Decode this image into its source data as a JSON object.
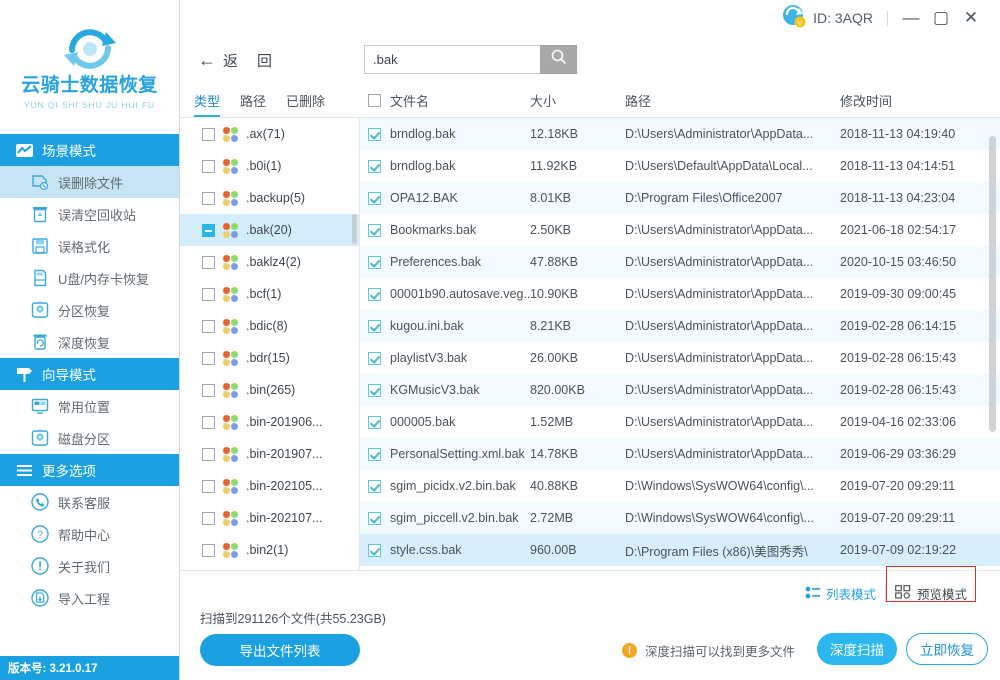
{
  "brand": {
    "title": "云骑士数据恢复",
    "subtitle": "YUN QI SHI SHU JU HUI FU",
    "version": "版本号: 3.21.0.17",
    "accent": "#1ba1e2",
    "accent_light": "#29b7e8"
  },
  "titlebar": {
    "id_label": "ID: 3AQR",
    "minimize": "—",
    "maximize": "▢",
    "close": "✕"
  },
  "toolbar": {
    "back_label": "返",
    "back_label2": "回",
    "search_value": ".bak",
    "search_placeholder": ""
  },
  "tree": {
    "tabs": [
      {
        "label": "类型",
        "active": true
      },
      {
        "label": "路径",
        "active": false
      },
      {
        "label": "已删除",
        "active": false
      }
    ],
    "items": [
      {
        "label": ".ax(71)",
        "state": "unchecked"
      },
      {
        "label": ".b0i(1)",
        "state": "unchecked"
      },
      {
        "label": ".backup(5)",
        "state": "unchecked"
      },
      {
        "label": ".bak(20)",
        "state": "partial"
      },
      {
        "label": ".baklz4(2)",
        "state": "unchecked"
      },
      {
        "label": ".bcf(1)",
        "state": "unchecked"
      },
      {
        "label": ".bdic(8)",
        "state": "unchecked"
      },
      {
        "label": ".bdr(15)",
        "state": "unchecked"
      },
      {
        "label": ".bin(265)",
        "state": "unchecked"
      },
      {
        "label": ".bin-201906...",
        "state": "unchecked"
      },
      {
        "label": ".bin-201907...",
        "state": "unchecked"
      },
      {
        "label": ".bin-202105...",
        "state": "unchecked"
      },
      {
        "label": ".bin-202107...",
        "state": "unchecked"
      },
      {
        "label": ".bin2(1)",
        "state": "unchecked"
      }
    ]
  },
  "filelist": {
    "columns": [
      "文件名",
      "大小",
      "路径",
      "修改时间"
    ],
    "rows": [
      {
        "name": "brndlog.bak",
        "size": "12.18KB",
        "path": "D:\\Users\\Administrator\\AppData...",
        "time": "2018-11-13 04:19:40",
        "checked": true
      },
      {
        "name": "brndlog.bak",
        "size": "11.92KB",
        "path": "D:\\Users\\Default\\AppData\\Local...",
        "time": "2018-11-13 04:14:51",
        "checked": true
      },
      {
        "name": "OPA12.BAK",
        "size": "8.01KB",
        "path": "D:\\Program Files\\Office2007",
        "time": "2018-11-13 04:23:04",
        "checked": true
      },
      {
        "name": "Bookmarks.bak",
        "size": "2.50KB",
        "path": "D:\\Users\\Administrator\\AppData...",
        "time": "2021-06-18 02:54:17",
        "checked": true
      },
      {
        "name": "Preferences.bak",
        "size": "47.88KB",
        "path": "D:\\Users\\Administrator\\AppData...",
        "time": "2020-10-15 03:46:50",
        "checked": true
      },
      {
        "name": "00001b90.autosave.veg....",
        "size": "10.90KB",
        "path": "D:\\Users\\Administrator\\AppData...",
        "time": "2019-09-30 09:00:45",
        "checked": true
      },
      {
        "name": "kugou.ini.bak",
        "size": "8.21KB",
        "path": "D:\\Users\\Administrator\\AppData...",
        "time": "2019-02-28 06:14:15",
        "checked": true
      },
      {
        "name": "playlistV3.bak",
        "size": "26.00KB",
        "path": "D:\\Users\\Administrator\\AppData...",
        "time": "2019-02-28 06:15:43",
        "checked": true
      },
      {
        "name": "KGMusicV3.bak",
        "size": "820.00KB",
        "path": "D:\\Users\\Administrator\\AppData...",
        "time": "2019-02-28 06:15:43",
        "checked": true
      },
      {
        "name": "000005.bak",
        "size": "1.52MB",
        "path": "D:\\Users\\Administrator\\AppData...",
        "time": "2019-04-16 02:33:06",
        "checked": true
      },
      {
        "name": "PersonalSetting.xml.bak",
        "size": "14.78KB",
        "path": "D:\\Users\\Administrator\\AppData...",
        "time": "2019-06-29 03:36:29",
        "checked": true
      },
      {
        "name": "sgim_picidx.v2.bin.bak",
        "size": "40.88KB",
        "path": "D:\\Windows\\SysWOW64\\config\\...",
        "time": "2019-07-20 09:29:11",
        "checked": true
      },
      {
        "name": "sgim_piccell.v2.bin.bak",
        "size": "2.72MB",
        "path": "D:\\Windows\\SysWOW64\\config\\...",
        "time": "2019-07-20 09:29:11",
        "checked": true
      },
      {
        "name": "style.css.bak",
        "size": "960.00B",
        "path": "D:\\Program Files (x86)\\美图秀秀\\",
        "time": "2019-07-09 02:19:22",
        "checked": true
      }
    ]
  },
  "sidebar": {
    "groups": [
      {
        "title": "场景模式",
        "icon": "scene-icon",
        "items": [
          {
            "label": "误删除文件",
            "icon": "deleted-file-icon",
            "active": true
          },
          {
            "label": "误清空回收站",
            "icon": "recycle-bin-icon",
            "active": false
          },
          {
            "label": "误格式化",
            "icon": "format-disk-icon",
            "active": false
          },
          {
            "label": "U盘/内存卡恢复",
            "icon": "usb-card-icon",
            "active": false
          },
          {
            "label": "分区恢复",
            "icon": "partition-icon",
            "active": false
          },
          {
            "label": "深度恢复",
            "icon": "deep-recover-icon",
            "active": false
          }
        ]
      },
      {
        "title": "向导模式",
        "icon": "guide-icon",
        "items": [
          {
            "label": "常用位置",
            "icon": "common-location-icon",
            "active": false
          },
          {
            "label": "磁盘分区",
            "icon": "disk-partition-icon",
            "active": false
          }
        ]
      },
      {
        "title": "更多选项",
        "icon": "menu-icon",
        "items": [
          {
            "label": "联系客服",
            "icon": "phone-icon",
            "active": false
          },
          {
            "label": "帮助中心",
            "icon": "help-icon",
            "active": false
          },
          {
            "label": "关于我们",
            "icon": "info-icon",
            "active": false
          },
          {
            "label": "导入工程",
            "icon": "import-icon",
            "active": false
          }
        ]
      }
    ]
  },
  "footer": {
    "scan_summary": "扫描到291126个文件(共55.23GB)",
    "export_label": "导出文件列表",
    "list_mode_label": "列表模式",
    "preview_mode_label": "预览模式",
    "hint_text": "深度扫描可以找到更多文件",
    "hint_icon": "!",
    "deep_scan_label": "深度扫描",
    "recover_label": "立即恢复",
    "highlight_color": "#d4342a"
  }
}
